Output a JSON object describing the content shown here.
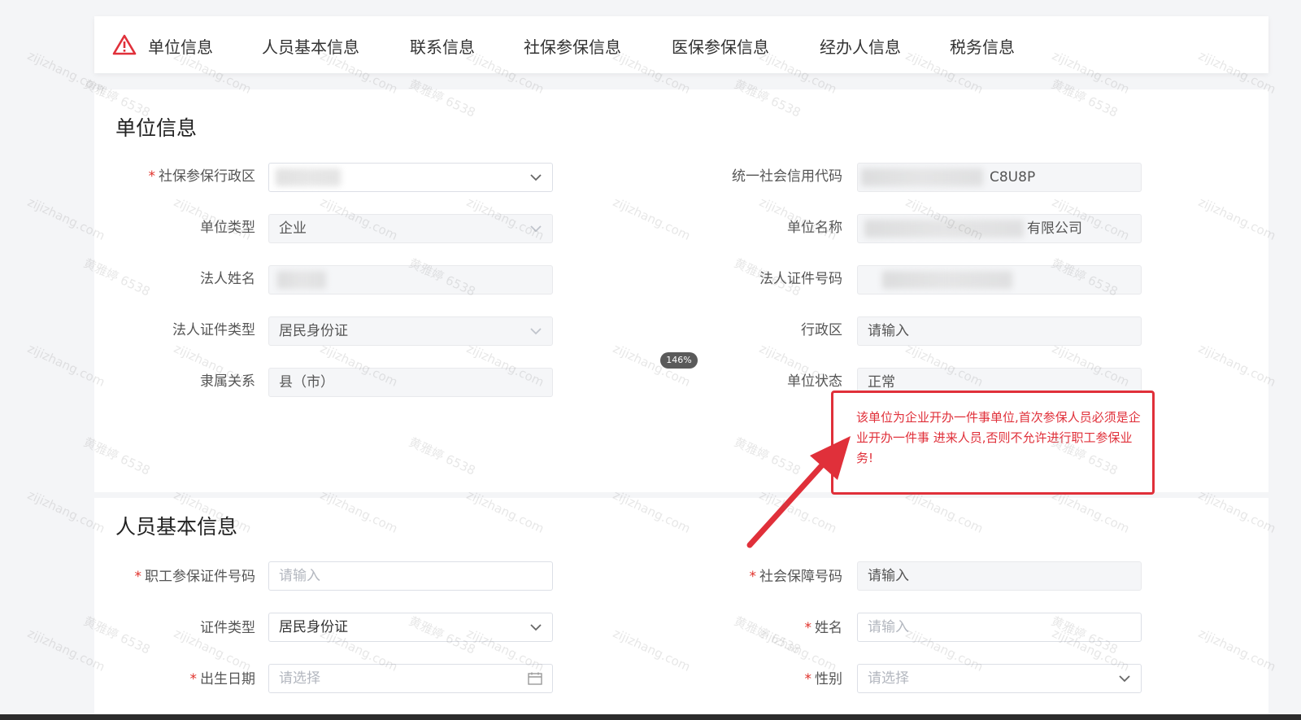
{
  "tabs": [
    "单位信息",
    "人员基本信息",
    "联系信息",
    "社保参保信息",
    "医保参保信息",
    "经办人信息",
    "税务信息"
  ],
  "unit_section": {
    "title": "单位信息",
    "fields": {
      "admin_region_ss": {
        "label": "社保参保行政区",
        "value": "",
        "required": true
      },
      "credit_code": {
        "label": "统一社会信用代码",
        "value": "C8U8P"
      },
      "unit_type": {
        "label": "单位类型",
        "value": "企业"
      },
      "unit_name": {
        "label": "单位名称",
        "value": "有限公司"
      },
      "legal_name": {
        "label": "法人姓名",
        "value": ""
      },
      "legal_id_no": {
        "label": "法人证件号码",
        "value": ""
      },
      "legal_id_type": {
        "label": "法人证件类型",
        "value": "居民身份证"
      },
      "admin_region": {
        "label": "行政区",
        "placeholder": "请输入"
      },
      "affiliation": {
        "label": "隶属关系",
        "value": "县（市）"
      },
      "unit_status": {
        "label": "单位状态",
        "value": "正常"
      }
    }
  },
  "person_section": {
    "title": "人员基本信息",
    "fields": {
      "worker_id_no": {
        "label": "职工参保证件号码",
        "placeholder": "请输入",
        "required": true
      },
      "ss_number": {
        "label": "社会保障号码",
        "placeholder": "请输入",
        "required": true
      },
      "id_type": {
        "label": "证件类型",
        "value": "居民身份证"
      },
      "name": {
        "label": "姓名",
        "placeholder": "请输入",
        "required": true
      },
      "birth_date": {
        "label": "出生日期",
        "placeholder": "请选择",
        "required": true
      },
      "gender": {
        "label": "性别",
        "placeholder": "请选择",
        "required": true
      }
    }
  },
  "annotation": {
    "text": "该单位为企业开办一件事单位,首次参保人员必须是企业开办一件事 进来人员,否则不允许进行职工参保业务!",
    "color": "#e0303a"
  },
  "zoom_badge": "146%",
  "watermarks": {
    "site": "zijizhang.com",
    "user": "黄雅婷 6538"
  },
  "colors": {
    "required": "#e0302a",
    "warning_icon": "#e0303a",
    "accent_red": "#e0303a"
  },
  "icons": {
    "warning": "warning-triangle-icon",
    "select": "chevron-down-icon",
    "date": "calendar-icon"
  }
}
